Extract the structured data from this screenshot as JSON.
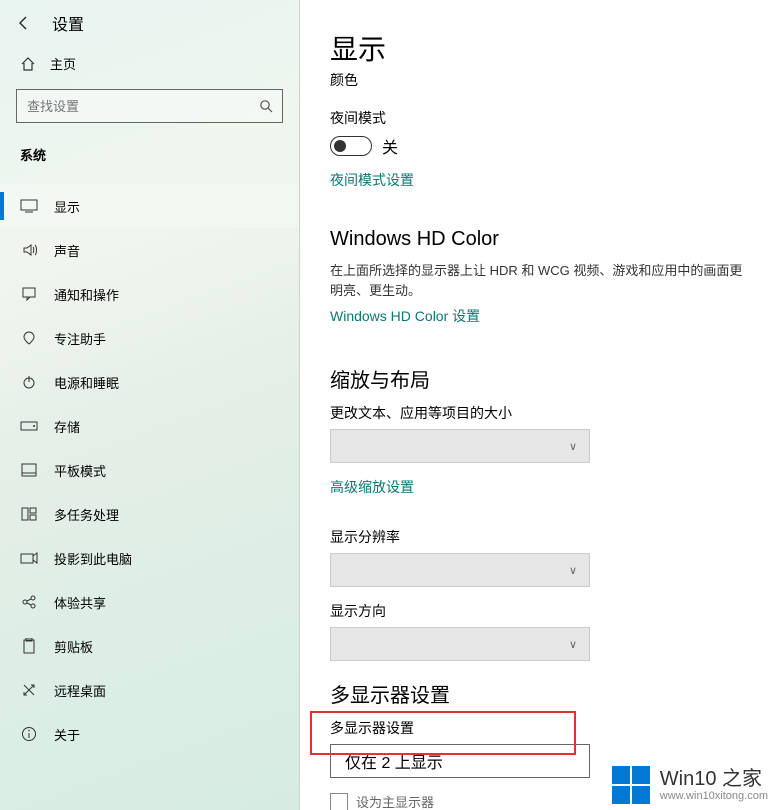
{
  "topbar": {
    "title": "设置"
  },
  "home_label": "主页",
  "search": {
    "placeholder": "查找设置"
  },
  "section_label": "系统",
  "nav": [
    {
      "label": "显示",
      "icon": "display",
      "active": true
    },
    {
      "label": "声音",
      "icon": "sound"
    },
    {
      "label": "通知和操作",
      "icon": "notify"
    },
    {
      "label": "专注助手",
      "icon": "focus"
    },
    {
      "label": "电源和睡眠",
      "icon": "power"
    },
    {
      "label": "存储",
      "icon": "storage"
    },
    {
      "label": "平板模式",
      "icon": "tablet"
    },
    {
      "label": "多任务处理",
      "icon": "multitask"
    },
    {
      "label": "投影到此电脑",
      "icon": "project"
    },
    {
      "label": "体验共享",
      "icon": "share"
    },
    {
      "label": "剪贴板",
      "icon": "clipboard"
    },
    {
      "label": "远程桌面",
      "icon": "remote"
    },
    {
      "label": "关于",
      "icon": "about"
    }
  ],
  "page": {
    "title": "显示",
    "color_label": "颜色",
    "night_mode_label": "夜间模式",
    "toggle_state": "关",
    "night_mode_link": "夜间模式设置",
    "hdcolor_title": "Windows HD Color",
    "hdcolor_desc": "在上面所选择的显示器上让 HDR 和 WCG 视频、游戏和应用中的画面更明亮、更生动。",
    "hdcolor_link": "Windows HD Color 设置",
    "scale_title": "缩放与布局",
    "scale_label": "更改文本、应用等项目的大小",
    "scale_link": "高级缩放设置",
    "res_label": "显示分辨率",
    "orient_label": "显示方向",
    "multi_title": "多显示器设置",
    "multi_label": "多显示器设置",
    "multi_value": "仅在 2 上显示",
    "primary_label": "设为主显示器"
  },
  "watermark": {
    "line1": "Win10 之家",
    "line2": "www.win10xitong.com"
  }
}
